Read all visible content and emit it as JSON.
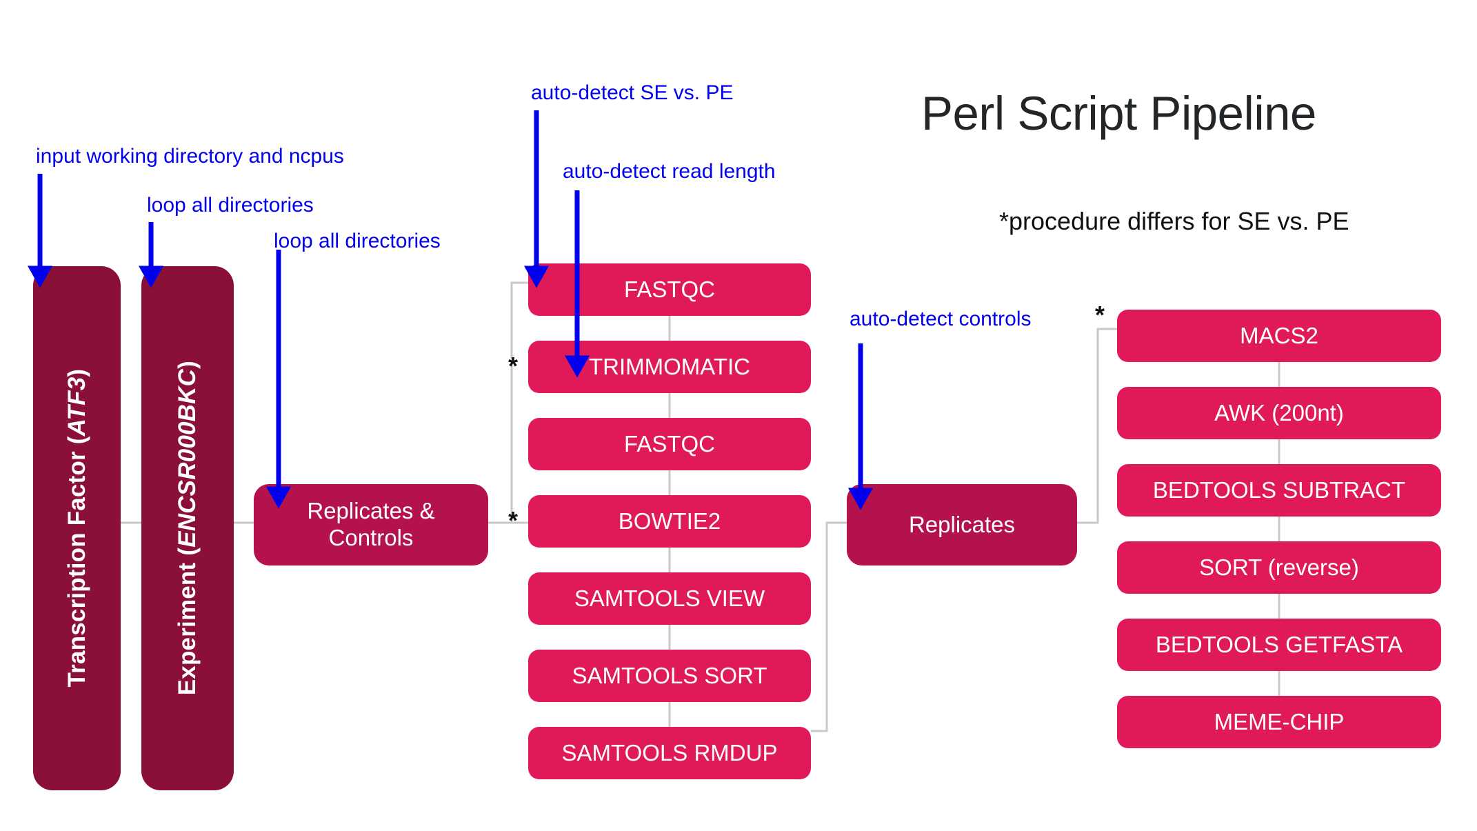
{
  "page": {
    "title": "Perl Script Pipeline",
    "subtitle": "*procedure differs for SE vs. PE",
    "background": "#ffffff"
  },
  "colors": {
    "dark_maroon": "#8B1038",
    "mid_crimson": "#B3124C",
    "bright_pink": "#E01A59",
    "annotation_blue": "#0000ee",
    "connector_gray": "#c9c9c9",
    "title_text": "#232629"
  },
  "annotations": [
    {
      "id": "ann-working-dir",
      "text": "input working directory and ncpus"
    },
    {
      "id": "ann-loop-dirs-1",
      "text": "loop all directories"
    },
    {
      "id": "ann-loop-dirs-2",
      "text": "loop all directories"
    },
    {
      "id": "ann-se-pe",
      "text": "auto-detect SE vs. PE"
    },
    {
      "id": "ann-read-length",
      "text": "auto-detect read length"
    },
    {
      "id": "ann-controls",
      "text": "auto-detect controls"
    }
  ],
  "columns": {
    "inputs": {
      "label": "input-nodes",
      "nodes": [
        {
          "id": "transcription-factor",
          "text_prefix": "Transcription Factor (",
          "text_italic": "ATF3",
          "text_suffix": ")",
          "color": "#8B1038"
        },
        {
          "id": "experiment",
          "text_prefix": "Experiment (",
          "text_italic": "ENCSR000BKC",
          "text_suffix": ")",
          "color": "#8B1038"
        }
      ]
    },
    "group_left": {
      "id": "replicates-and-controls",
      "line1": "Replicates &",
      "line2": "Controls",
      "color": "#B3124C"
    },
    "group_right": {
      "id": "replicates",
      "text": "Replicates",
      "color": "#B3124C"
    },
    "processing": {
      "label": "processing-steps",
      "steps": [
        {
          "id": "fastqc-1",
          "text": "FASTQC",
          "starred": false
        },
        {
          "id": "trimmomatic",
          "text": "TRIMMOMATIC",
          "starred": true
        },
        {
          "id": "fastqc-2",
          "text": "FASTQC",
          "starred": false
        },
        {
          "id": "bowtie2",
          "text": "BOWTIE2",
          "starred": true
        },
        {
          "id": "samtools-view",
          "text": "SAMTOOLS VIEW",
          "starred": false
        },
        {
          "id": "samtools-sort",
          "text": "SAMTOOLS SORT",
          "starred": false
        },
        {
          "id": "samtools-rmdup",
          "text": "SAMTOOLS RMDUP",
          "starred": false
        }
      ]
    },
    "peak_calling": {
      "label": "peak-calling-steps",
      "steps": [
        {
          "id": "macs2",
          "text": "MACS2",
          "starred": true
        },
        {
          "id": "awk-200nt",
          "text": "AWK (200nt)",
          "starred": false
        },
        {
          "id": "bedtools-subtract",
          "text": "BEDTOOLS SUBTRACT",
          "starred": false
        },
        {
          "id": "sort-reverse",
          "text": "SORT (reverse)",
          "starred": false
        },
        {
          "id": "bedtools-getfasta",
          "text": "BEDTOOLS GETFASTA",
          "starred": false
        },
        {
          "id": "meme-chip",
          "text": "MEME-CHIP",
          "starred": false
        }
      ]
    }
  },
  "star_marker": "*"
}
